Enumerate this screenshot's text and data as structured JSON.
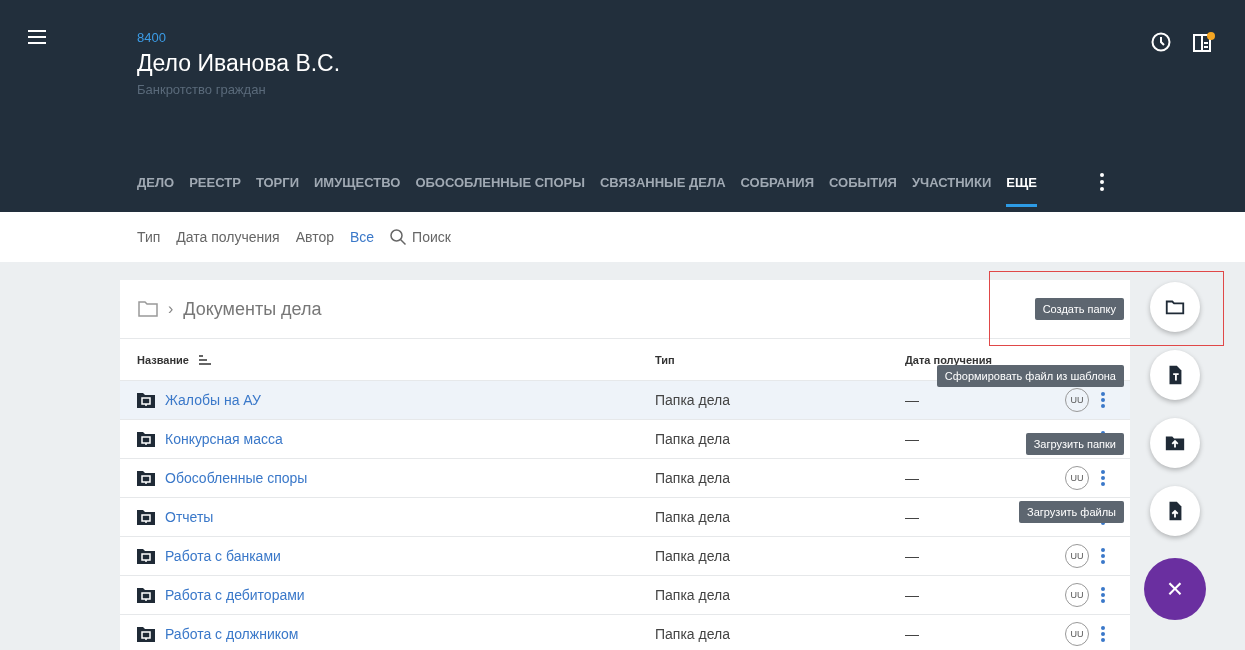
{
  "header": {
    "case_number": "8400",
    "title": "Дело Иванова В.С.",
    "subtitle": "Банкротство граждан",
    "notification_dot": true
  },
  "tabs": [
    {
      "label": "ДЕЛО",
      "selected": false
    },
    {
      "label": "РЕЕСТР",
      "selected": false
    },
    {
      "label": "ТОРГИ",
      "selected": false
    },
    {
      "label": "ИМУЩЕСТВО",
      "selected": false
    },
    {
      "label": "ОБОСОБЛЕННЫЕ СПОРЫ",
      "selected": false
    },
    {
      "label": "СВЯЗАННЫЕ ДЕЛА",
      "selected": false
    },
    {
      "label": "СОБРАНИЯ",
      "selected": false
    },
    {
      "label": "СОБЫТИЯ",
      "selected": false
    },
    {
      "label": "УЧАСТНИКИ",
      "selected": false
    },
    {
      "label": "ЕЩЕ",
      "selected": true
    }
  ],
  "filters": [
    {
      "label": "Тип",
      "selected": false
    },
    {
      "label": "Дата получения",
      "selected": false
    },
    {
      "label": "Автор",
      "selected": false
    },
    {
      "label": "Все",
      "selected": true
    }
  ],
  "search": {
    "placeholder": "Поиск"
  },
  "breadcrumb_separator": "›",
  "breadcrumb": "Документы дела",
  "table": {
    "columns": [
      "Название",
      "Тип",
      "Дата получения"
    ],
    "rows": [
      {
        "name": "Жалобы на АУ",
        "type": "Папка дела",
        "date": "—",
        "avatar": "UU",
        "selected": true
      },
      {
        "name": "Конкурсная масса",
        "type": "Папка дела",
        "date": "—",
        "selected": false
      },
      {
        "name": "Обособленные споры",
        "type": "Папка дела",
        "date": "—",
        "avatar": "UU",
        "selected": false
      },
      {
        "name": "Отчеты",
        "type": "Папка дела",
        "date": "—",
        "selected": false
      },
      {
        "name": "Работа с банками",
        "type": "Папка дела",
        "date": "—",
        "avatar": "UU",
        "selected": false
      },
      {
        "name": "Работа с дебиторами",
        "type": "Папка дела",
        "date": "—",
        "avatar": "UU",
        "selected": false
      },
      {
        "name": "Работа с должником",
        "type": "Папка дела",
        "date": "—",
        "avatar": "UU",
        "selected": false
      }
    ]
  },
  "actions": [
    {
      "kind": "folder",
      "tooltip": "Создать папку"
    },
    {
      "kind": "template",
      "tooltip": "Сформировать файл из шаблона"
    },
    {
      "kind": "upload-folder",
      "tooltip": "Загрузить папки"
    },
    {
      "kind": "upload-file",
      "tooltip": "Загрузить файлы"
    }
  ],
  "highlight_frame": true,
  "close_fab": "×"
}
